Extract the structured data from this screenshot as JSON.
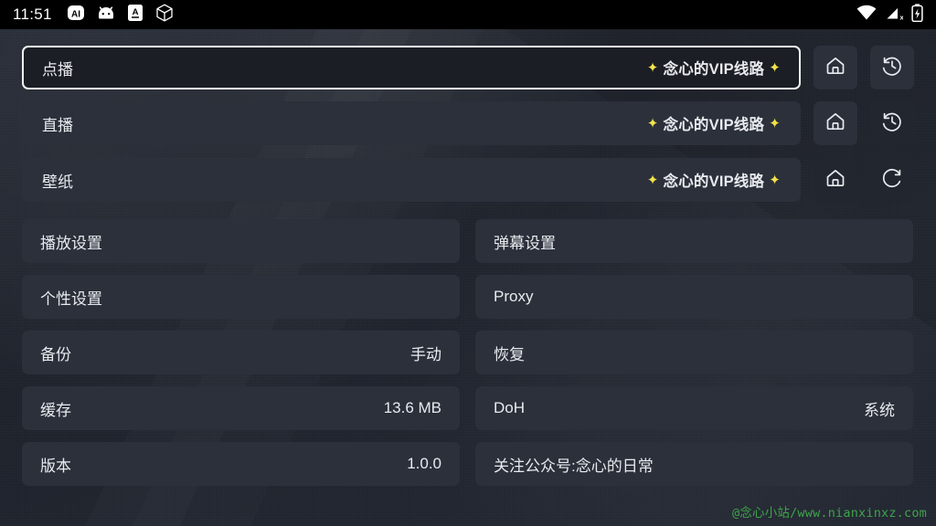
{
  "statusbar": {
    "clock": "11:51",
    "left_icons": [
      {
        "name": "ai-assistant-icon",
        "glyph": "AI"
      },
      {
        "name": "android-robot-icon",
        "glyph": "android"
      },
      {
        "name": "app-a-icon",
        "glyph": "A"
      },
      {
        "name": "cube-icon",
        "glyph": "cube"
      }
    ],
    "right_icons": [
      {
        "name": "wifi-icon",
        "glyph": "wifi"
      },
      {
        "name": "cellular-signal-off-icon",
        "glyph": "signal-x"
      },
      {
        "name": "battery-charging-icon",
        "glyph": "battery-bolt"
      }
    ]
  },
  "source_rows": [
    {
      "label": "点播",
      "value": "念心的VIP线路",
      "spark_left": "✦",
      "spark_right": "✦",
      "focused": true,
      "buttons": [
        {
          "name": "home-button",
          "icon": "home-icon"
        },
        {
          "name": "history-button",
          "icon": "history-icon"
        }
      ]
    },
    {
      "label": "直播",
      "value": "念心的VIP线路",
      "spark_left": "✦",
      "spark_right": "✦",
      "focused": false,
      "buttons": [
        {
          "name": "home-button",
          "icon": "home-icon"
        },
        {
          "name": "history-button",
          "icon": "history-icon"
        }
      ]
    },
    {
      "label": "壁纸",
      "value": "念心的VIP线路",
      "spark_left": "✦",
      "spark_right": "✦",
      "focused": false,
      "buttons": [
        {
          "name": "home-button",
          "icon": "home-icon"
        },
        {
          "name": "refresh-button",
          "icon": "refresh-icon"
        }
      ]
    }
  ],
  "settings": [
    {
      "key": "播放设置",
      "value": ""
    },
    {
      "key": "弹幕设置",
      "value": ""
    },
    {
      "key": "个性设置",
      "value": ""
    },
    {
      "key": "Proxy",
      "value": ""
    },
    {
      "key": "备份",
      "value": "手动"
    },
    {
      "key": "恢复",
      "value": ""
    },
    {
      "key": "缓存",
      "value": "13.6 MB"
    },
    {
      "key": "DoH",
      "value": "系统"
    },
    {
      "key": "版本",
      "value": "1.0.0"
    },
    {
      "key": "关注公众号:念心的日常",
      "value": ""
    }
  ],
  "watermark": "@念心小站/www.nianxinxz.com",
  "colors": {
    "background": "#20242e",
    "row": "#2b303b",
    "row_focused_bg": "#1b1e25",
    "focus_border": "#f2f3f5",
    "text": "#e8eaee",
    "spark": "#f4e24a",
    "watermark": "#3fa24a",
    "statusbar": "#000000"
  }
}
